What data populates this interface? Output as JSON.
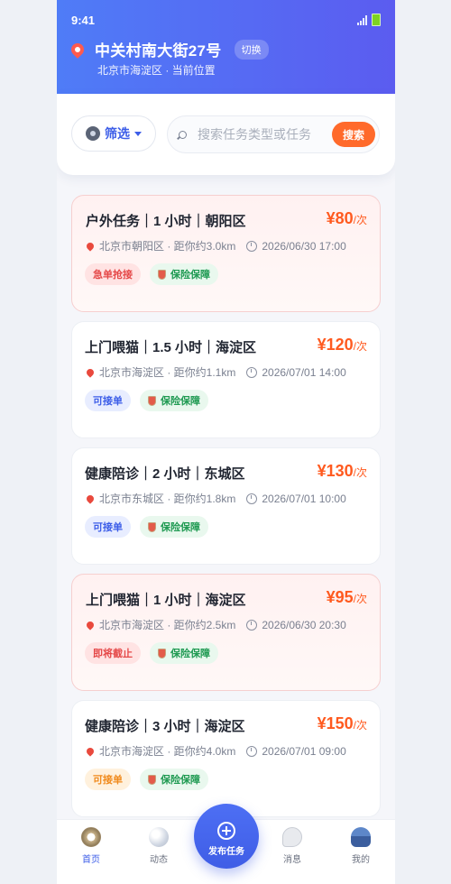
{
  "status_bar": {
    "time": "9:41"
  },
  "location": {
    "title": "中关村南大街27号",
    "switch_label": "切换",
    "subtitle": "北京市海淀区 · 当前位置"
  },
  "search": {
    "filter_label": "筛选",
    "placeholder": "搜索任务类型或任务",
    "value": "",
    "button_label": "搜索"
  },
  "tasks": [
    {
      "title": "户外任务｜1 小时｜朝阳区",
      "price": "¥80",
      "unit": "/次",
      "location": "北京市朝阳区 · 距你约3.0km",
      "time": "2026/06/30 17:00",
      "tag": "急单抢接",
      "insurance": "保险保障"
    },
    {
      "title": "上门喂猫｜1.5 小时｜海淀区",
      "price": "¥120",
      "unit": "/次",
      "location": "北京市海淀区 · 距你约1.1km",
      "time": "2026/07/01 14:00",
      "tag": "可接单",
      "insurance": "保险保障"
    },
    {
      "title": "健康陪诊｜2 小时｜东城区",
      "price": "¥130",
      "unit": "/次",
      "location": "北京市东城区 · 距你约1.8km",
      "time": "2026/07/01 10:00",
      "tag": "可接单",
      "insurance": "保险保障"
    },
    {
      "title": "上门喂猫｜1 小时｜海淀区",
      "price": "¥95",
      "unit": "/次",
      "location": "北京市海淀区 · 距你约2.5km",
      "time": "2026/06/30 20:30",
      "tag": "即将截止",
      "insurance": "保险保障"
    },
    {
      "title": "健康陪诊｜3 小时｜海淀区",
      "price": "¥150",
      "unit": "/次",
      "location": "北京市海淀区 · 距你约4.0km",
      "time": "2026/07/01 09:00",
      "tag": "可接单",
      "insurance": "保险保障"
    }
  ],
  "tabbar": {
    "home": "首页",
    "feed": "动态",
    "publish": "发布任务",
    "messages": "消息",
    "me": "我的"
  },
  "colors": {
    "brand": "#4f7cf7",
    "accent": "#ff6a2b",
    "price": "#ff5a1f"
  },
  "icons": [
    "pin-icon",
    "gear-icon",
    "search-icon",
    "clock-icon",
    "shield-icon",
    "compass-icon",
    "bubbles-icon",
    "plus-icon",
    "chat-icon",
    "person-icon"
  ]
}
